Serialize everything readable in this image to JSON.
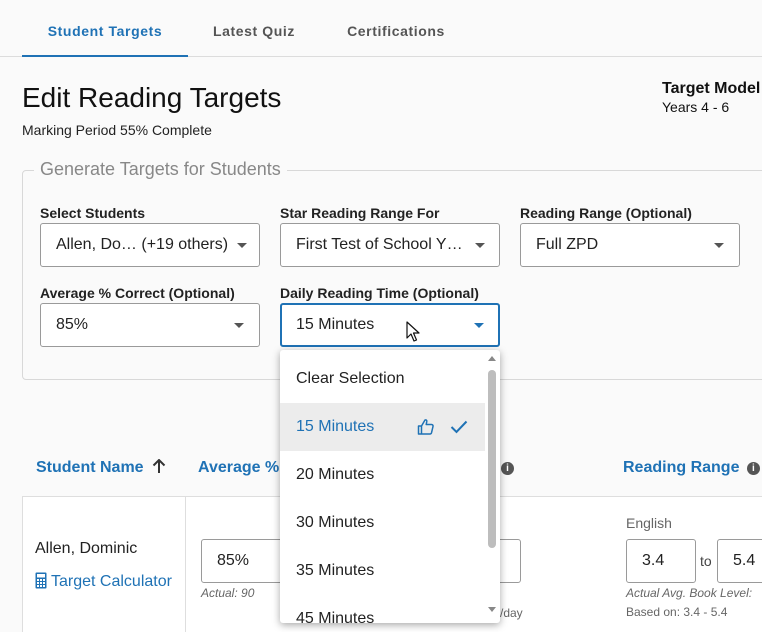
{
  "tabs": [
    {
      "label": "Student Targets",
      "active": true
    },
    {
      "label": "Latest Quiz",
      "active": false
    },
    {
      "label": "Certifications",
      "active": false
    }
  ],
  "page": {
    "title": "Edit Reading Targets",
    "marking_period": "Marking Period 55% Complete",
    "target_model_title": "Target Model",
    "target_model_value": "Years 4 - 6"
  },
  "generate": {
    "legend": "Generate Targets for Students",
    "select_students": {
      "label": "Select Students",
      "value": "Allen, Do… (+19 others)"
    },
    "star_range": {
      "label": "Star Reading Range For",
      "value": "First Test of School Y…"
    },
    "reading_range": {
      "label": "Reading Range (Optional)",
      "value": "Full ZPD"
    },
    "avg_correct": {
      "label": "Average % Correct (Optional)",
      "value": "85%"
    },
    "daily_time": {
      "label": "Daily Reading Time (Optional)",
      "value": "15 Minutes"
    }
  },
  "dropdown": {
    "options": [
      "Clear Selection",
      "15 Minutes",
      "20 Minutes",
      "30 Minutes",
      "35 Minutes",
      "45 Minutes"
    ],
    "selected_index": 1
  },
  "table": {
    "col_student": "Student Name",
    "col_avg": "Average % C",
    "col_range": "Reading Range",
    "row": {
      "name": "Allen, Dominic",
      "calculator_link": "Target Calculator",
      "avg_value": "85%",
      "avg_actual": "Actual: 90",
      "time_hint": "/day",
      "lang": "English",
      "range_from": "3.4",
      "range_to_word": "to",
      "range_to": "5.4",
      "actual_level": "Actual Avg. Book Level:",
      "based_on": "Based on: 3.4 - 5.4"
    }
  },
  "colors": {
    "accent": "#1f72b5",
    "selected_bg": "#ececec"
  },
  "icons": [
    "sort-up-arrow-icon",
    "info-icon",
    "calculator-icon",
    "thumbs-up-icon",
    "check-icon",
    "chevron-down-icon",
    "cursor-arrow-icon"
  ]
}
